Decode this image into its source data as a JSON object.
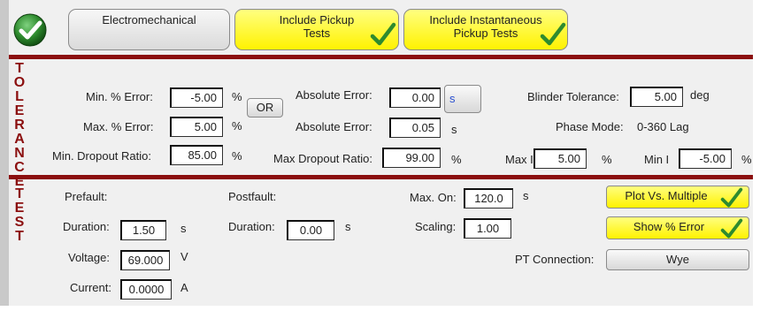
{
  "header": {
    "electromechanical_label": "Electromechanical",
    "pickup_line1": "Include Pickup",
    "pickup_line2": "Tests",
    "instant_line1": "Include Instantaneous",
    "instant_line2": "Pickup Tests"
  },
  "tolerance": {
    "section_title": "TOLERANCE",
    "min_pct_error_label": "Min. % Error:",
    "min_pct_error_value": "-5.00",
    "max_pct_error_label": "Max. % Error:",
    "max_pct_error_value": "5.00",
    "pct_unit": "%",
    "or_label": "OR",
    "abs_error_label": "Absolute Error:",
    "abs_error_1_value": "0.00",
    "abs_error_1_unit": "s",
    "abs_error_2_value": "0.05",
    "abs_error_2_unit": "s",
    "blinder_label": "Blinder Tolerance:",
    "blinder_value": "5.00",
    "blinder_unit": "deg",
    "phase_mode_label": "Phase Mode:",
    "phase_mode_value": "0-360 Lag",
    "min_dropout_label": "Min. Dropout Ratio:",
    "min_dropout_value": "85.00",
    "max_dropout_label": "Max Dropout Ratio:",
    "max_dropout_value": "99.00",
    "max_i_label": "Max I",
    "max_i_value": "5.00",
    "min_i_label": "Min I",
    "min_i_value": "-5.00"
  },
  "test": {
    "section_title": "TEST",
    "prefault_label": "Prefault:",
    "postfault_label": "Postfault:",
    "duration_label": "Duration:",
    "pre_duration_value": "1.50",
    "post_duration_value": "0.00",
    "sec_unit": "s",
    "voltage_label": "Voltage:",
    "voltage_value": "69.000",
    "voltage_unit": "V",
    "current_label": "Current:",
    "current_value": "0.0000",
    "current_unit": "A",
    "max_on_label": "Max. On:",
    "max_on_value": "120.0",
    "scaling_label": "Scaling:",
    "scaling_value": "1.00",
    "plot_vs_multiple_label": "Plot Vs. Multiple",
    "show_pct_error_label": "Show % Error",
    "pt_connection_label": "PT Connection:",
    "pt_connection_value": "Wye"
  },
  "colors": {
    "accent_maroon": "#8b0f0f",
    "button_yellow": "#fff200",
    "check_green": "#2e8b2e"
  }
}
